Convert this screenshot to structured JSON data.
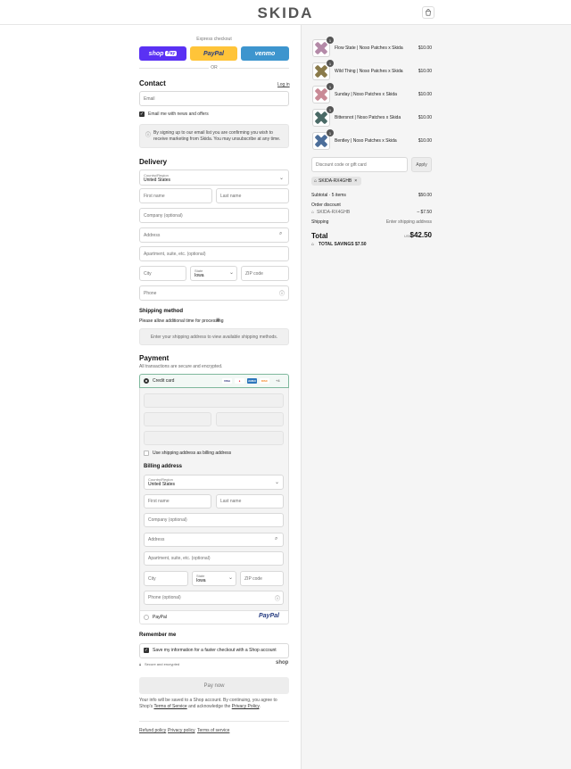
{
  "header": {
    "logo": "SKIDA",
    "bag_icon": "shopping-bag-icon"
  },
  "express": {
    "label": "Express checkout",
    "shop_pay": "shop",
    "shop_pay_badge": "Pay",
    "paypal": "PayPal",
    "venmo": "venmo",
    "or": "OR"
  },
  "contact": {
    "title": "Contact",
    "login": "Log in",
    "email_placeholder": "Email",
    "news_label": "Email me with news and offers",
    "notice": "By signing up to our email list you are confirming you wish to receive marketing from Skida. You may unsubscribe at any time."
  },
  "delivery": {
    "title": "Delivery",
    "country_label": "Country/Region",
    "country": "United States",
    "first": "First name",
    "last": "Last name",
    "company": "Company (optional)",
    "address": "Address",
    "apartment": "Apartment, suite, etc. (optional)",
    "city": "City",
    "state_label": "State",
    "state": "Iowa",
    "zip": "ZIP code",
    "phone": "Phone"
  },
  "shipping": {
    "title": "Shipping method",
    "note": "Please allow additional time for processing",
    "info": "Enter your shipping address to view available shipping methods."
  },
  "payment": {
    "title": "Payment",
    "subtitle": "All transactions are secure and encrypted.",
    "credit_card": "Credit card",
    "cards": [
      "VISA",
      "MC",
      "AMEX",
      "DISC",
      "+4"
    ],
    "use_shipping": "Use shipping address as billing address",
    "billing_title": "Billing address",
    "paypal": "PayPal",
    "paypal_logo": "PayPal"
  },
  "billing": {
    "country_label": "Country/Region",
    "country": "United States",
    "first": "First name",
    "last": "Last name",
    "company": "Company (optional)",
    "address": "Address",
    "apartment": "Apartment, suite, etc. (optional)",
    "city": "City",
    "state_label": "State",
    "state": "Iowa",
    "zip": "ZIP code",
    "phone": "Phone (optional)"
  },
  "remember": {
    "title": "Remember me",
    "save_label": "Save my information for a faster checkout with a Shop account",
    "secure": "Secure and encrypted",
    "shop": "shop"
  },
  "pay_button": "Pay now",
  "legal": {
    "line1": "Your info will be saved to a Shop account. By continuing, you agree to Shop's",
    "tos": "Terms of Service",
    "and": "and acknowledge the",
    "privacy": "Privacy Policy",
    "end": "."
  },
  "footer": {
    "refund": "Refund policy",
    "privacy": "Privacy policy",
    "terms": "Terms of service"
  },
  "summary": {
    "items": [
      {
        "qty": "1",
        "name": "Flow State | Noso Patches x Skida",
        "price": "$10.00",
        "color": "#b48aa8"
      },
      {
        "qty": "1",
        "name": "Wild Thing | Noso Patches x Skida",
        "price": "$10.00",
        "color": "#8a7a4a"
      },
      {
        "qty": "1",
        "name": "Sunday | Noso Patches x Skida",
        "price": "$10.00",
        "color": "#c98a96"
      },
      {
        "qty": "1",
        "name": "Bittersnot | Noso Patches x Skida",
        "price": "$10.00",
        "color": "#4a6a66"
      },
      {
        "qty": "1",
        "name": "Bentley | Noso Patches x Skida",
        "price": "$10.00",
        "color": "#4c6e9a"
      }
    ],
    "discount_placeholder": "Discount code or gift card",
    "apply": "Apply",
    "code": "SKIDA-RX4GHB",
    "subtotal_label": "Subtotal · 5 items",
    "subtotal": "$50.00",
    "order_discount": "Order discount",
    "discount_code": "SKIDA-RX4GHB",
    "discount_amount": "– $7.50",
    "shipping_label": "Shipping",
    "shipping_value": "Enter shipping address",
    "total_label": "Total",
    "currency": "USD",
    "total": "$42.50",
    "savings_label": "TOTAL SAVINGS",
    "savings": "$7.50"
  }
}
